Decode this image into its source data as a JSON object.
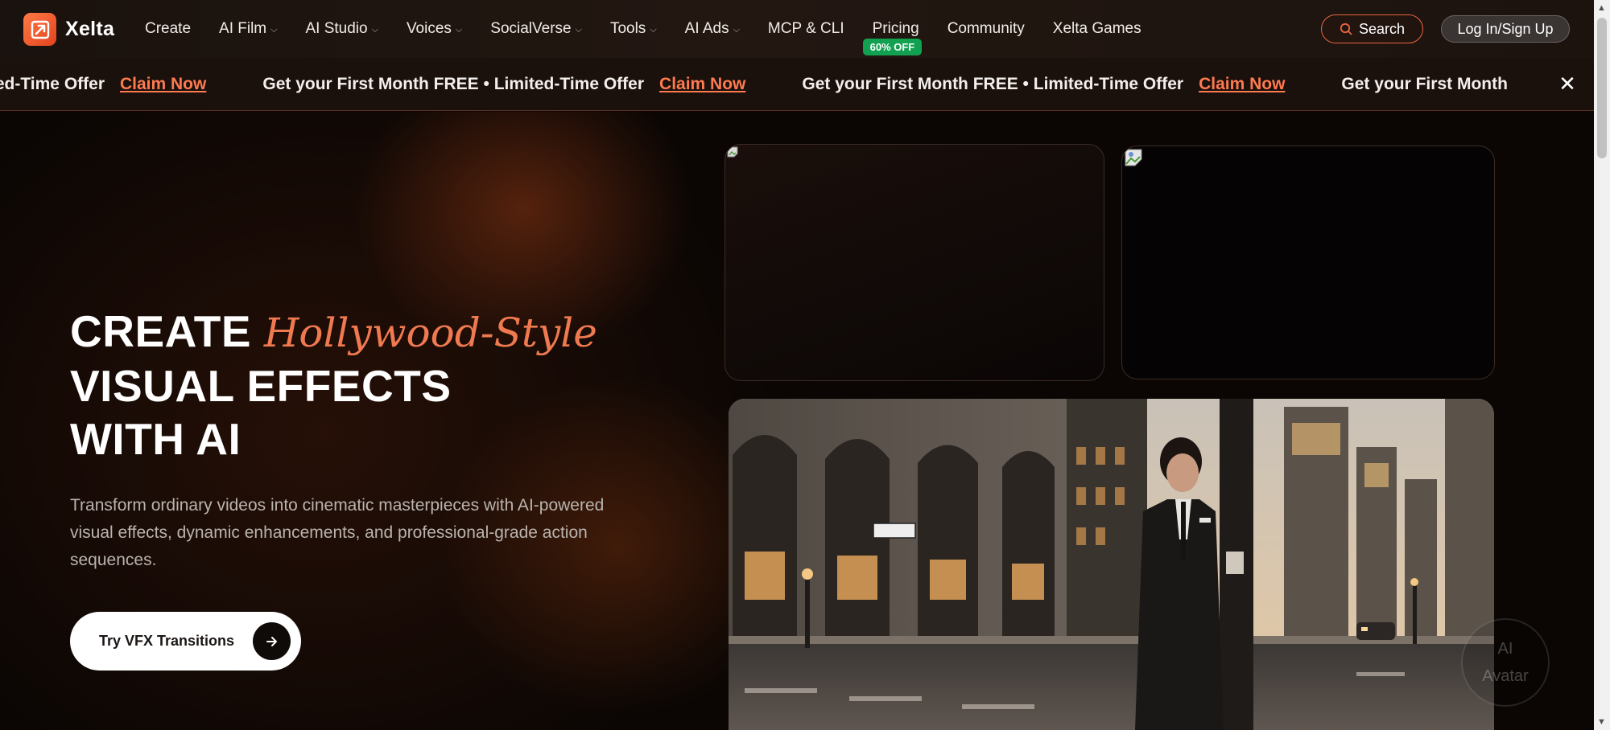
{
  "brand": {
    "name": "Xelta",
    "accent": "#f07a50"
  },
  "nav": {
    "items": [
      {
        "label": "Create",
        "dropdown": false
      },
      {
        "label": "AI Film",
        "dropdown": true
      },
      {
        "label": "AI Studio",
        "dropdown": true
      },
      {
        "label": "Voices",
        "dropdown": true
      },
      {
        "label": "SocialVerse",
        "dropdown": true
      },
      {
        "label": "Tools",
        "dropdown": true
      },
      {
        "label": "AI Ads",
        "dropdown": true
      },
      {
        "label": "MCP & CLI",
        "dropdown": false
      },
      {
        "label": "Pricing",
        "dropdown": false,
        "badge": "60% OFF"
      },
      {
        "label": "Community",
        "dropdown": false
      },
      {
        "label": "Xelta Games",
        "dropdown": false
      }
    ],
    "search_label": "Search",
    "login_label": "Log In/Sign Up"
  },
  "promo": {
    "head_fragment": "n FREE • Limited-Time Offer",
    "message": "Get your First Month FREE • Limited-Time Offer",
    "tail_fragment": "Get your First Month",
    "claim_label": "Claim Now",
    "close_icon": "close-icon"
  },
  "hero": {
    "headline_word": "CREATE",
    "headline_italic": "Hollywood-Style",
    "headline_line2": "VISUAL EFFECTS",
    "headline_line3": "WITH AI",
    "subtext": "Transform ordinary videos into cinematic masterpieces with AI-powered visual effects, dynamic enhancements, and professional-grade action sequences.",
    "cta_label": "Try VFX Transitions",
    "cta_icon": "arrow-right-icon"
  },
  "floating": {
    "avatar_label_line1": "AI",
    "avatar_label_line2": "Avatar"
  }
}
